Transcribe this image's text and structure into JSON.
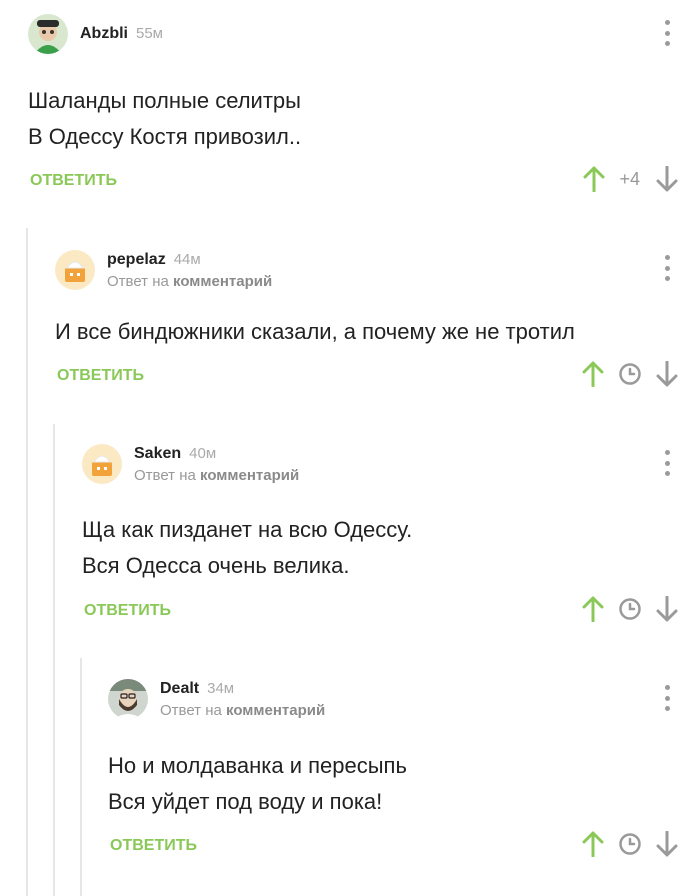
{
  "colors": {
    "accent": "#8ac858",
    "muted": "#9a9a9a",
    "text": "#222222"
  },
  "comments": [
    {
      "username": "Abzbli",
      "time": "55м",
      "reply_to": null,
      "text": [
        "Шаланды полные селитры",
        "В Одессу Костя привозил.."
      ],
      "reply_label": "ОТВЕТИТЬ",
      "score": "+4",
      "icons": [
        "upvote-arrow-icon",
        "downvote-arrow-icon"
      ]
    },
    {
      "username": "pepelaz",
      "time": "44м",
      "reply_prefix": "Ответ на",
      "reply_target": "комментарий",
      "text": [
        "И все биндюжники сказали, а почему же не тротил"
      ],
      "reply_label": "ОТВЕТИТЬ",
      "icons": [
        "upvote-arrow-icon",
        "clock-icon",
        "downvote-arrow-icon"
      ]
    },
    {
      "username": "Saken",
      "time": "40м",
      "reply_prefix": "Ответ на",
      "reply_target": "комментарий",
      "text": [
        "Ща как пизданет на всю Одессу.",
        "Вся Одесса очень велика."
      ],
      "reply_label": "ОТВЕТИТЬ",
      "icons": [
        "upvote-arrow-icon",
        "clock-icon",
        "downvote-arrow-icon"
      ]
    },
    {
      "username": "Dealt",
      "time": "34м",
      "reply_prefix": "Ответ на",
      "reply_target": "комментарий",
      "text": [
        "Но и молдаванка и пересыпь",
        "Вся уйдет под воду и пока!"
      ],
      "reply_label": "ОТВЕТИТЬ",
      "icons": [
        "upvote-arrow-icon",
        "clock-icon",
        "downvote-arrow-icon"
      ]
    }
  ]
}
